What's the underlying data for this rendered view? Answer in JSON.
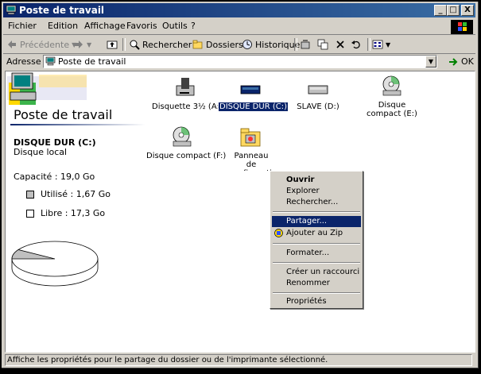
{
  "window": {
    "title": "Poste de travail",
    "buttons": {
      "minimize": "_",
      "maximize": "□",
      "close": "X"
    }
  },
  "menubar": {
    "items": [
      "Fichier",
      "Edition",
      "Affichage",
      "Favoris",
      "Outils",
      "?"
    ]
  },
  "toolbar": {
    "back": "Précédente",
    "search": "Rechercher",
    "folders": "Dossiers",
    "history": "Historique"
  },
  "address": {
    "label": "Adresse",
    "value": "Poste de travail",
    "go": "OK"
  },
  "left_panel": {
    "title": "Poste de travail",
    "drive_name": "DISQUE DUR (C:)",
    "drive_type": "Disque local",
    "capacity": "Capacité : 19,0 Go",
    "used": "Utilisé : 1,67 Go",
    "free": "Libre : 17,3 Go",
    "used_fraction": 0.088,
    "colors": {
      "used": "#c0c0c0",
      "free": "#ffffff"
    }
  },
  "icons": [
    {
      "label": "Disquette 3½ (A:)",
      "kind": "floppy-icon"
    },
    {
      "label": "DISQUE DUR (C:)",
      "kind": "harddisk-icon",
      "selected": true
    },
    {
      "label": "SLAVE (D:)",
      "kind": "harddisk-icon"
    },
    {
      "label": "Disque compact (E:)",
      "kind": "cdrom-icon"
    },
    {
      "label": "Disque compact (F:)",
      "kind": "cdrom-icon"
    },
    {
      "label": "Panneau de configuration",
      "kind": "control-panel-icon"
    }
  ],
  "context_menu": {
    "items": [
      {
        "label": "Ouvrir",
        "bold": true
      },
      {
        "label": "Explorer"
      },
      {
        "label": "Rechercher..."
      },
      {
        "label": "Partager...",
        "highlighted": true
      },
      {
        "label": "Ajouter au Zip",
        "icon": "zip-icon"
      },
      {
        "label": "Formater..."
      },
      {
        "label": "Créer un raccourci"
      },
      {
        "label": "Renommer"
      },
      {
        "label": "Propriétés"
      }
    ]
  },
  "statusbar": {
    "text": "Affiche les propriétés pour le partage du dossier ou de l'imprimante sélectionné."
  }
}
